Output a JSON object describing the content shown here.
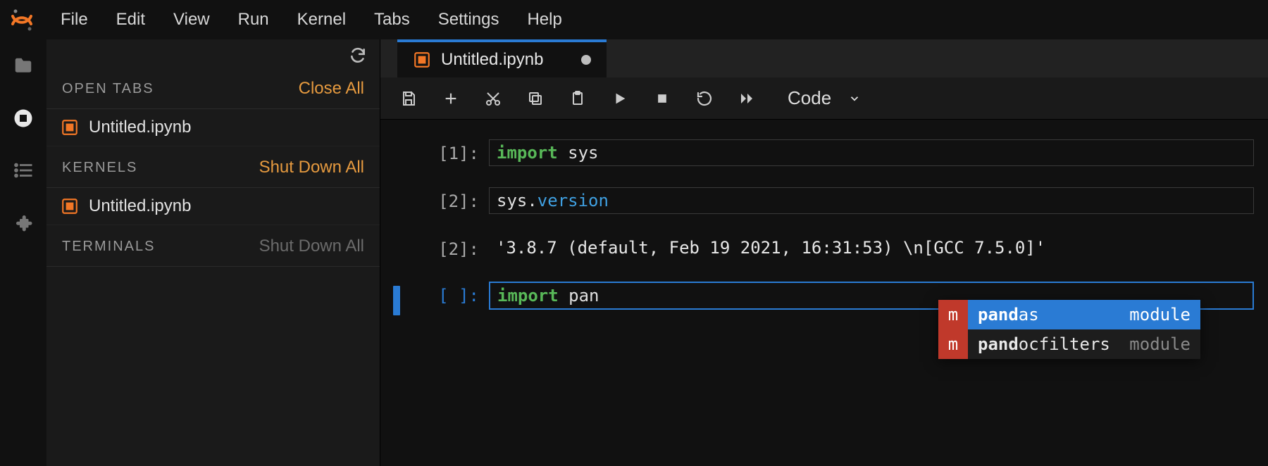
{
  "menubar": [
    "File",
    "Edit",
    "View",
    "Run",
    "Kernel",
    "Tabs",
    "Settings",
    "Help"
  ],
  "sidebar": {
    "sections": [
      {
        "title": "OPEN TABS",
        "action": "Close All",
        "action_enabled": true,
        "items": [
          {
            "label": "Untitled.ipynb"
          }
        ]
      },
      {
        "title": "KERNELS",
        "action": "Shut Down All",
        "action_enabled": true,
        "items": [
          {
            "label": "Untitled.ipynb"
          }
        ]
      },
      {
        "title": "TERMINALS",
        "action": "Shut Down All",
        "action_enabled": false,
        "items": []
      }
    ]
  },
  "tab": {
    "label": "Untitled.ipynb",
    "dirty": true
  },
  "toolbar": {
    "celltype": "Code"
  },
  "cells": [
    {
      "prompt": "[1]:",
      "code_html": "<span class='kw'>import</span> sys"
    },
    {
      "prompt": "[2]:",
      "code_html": "sys.<span class='attr'>version</span>"
    },
    {
      "prompt": "[2]:",
      "output": "'3.8.7 (default, Feb 19 2021, 16:31:53) \\n[GCC 7.5.0]'"
    },
    {
      "prompt": "[ ]:",
      "active": true,
      "code_html": "<span class='kw'>import</span> pan"
    }
  ],
  "completion": {
    "items": [
      {
        "badge": "m",
        "prefix": "pand",
        "rest": "as",
        "kind": "module",
        "selected": true
      },
      {
        "badge": "m",
        "prefix": "pand",
        "rest": "ocfilters",
        "kind": "module",
        "selected": false
      }
    ]
  }
}
